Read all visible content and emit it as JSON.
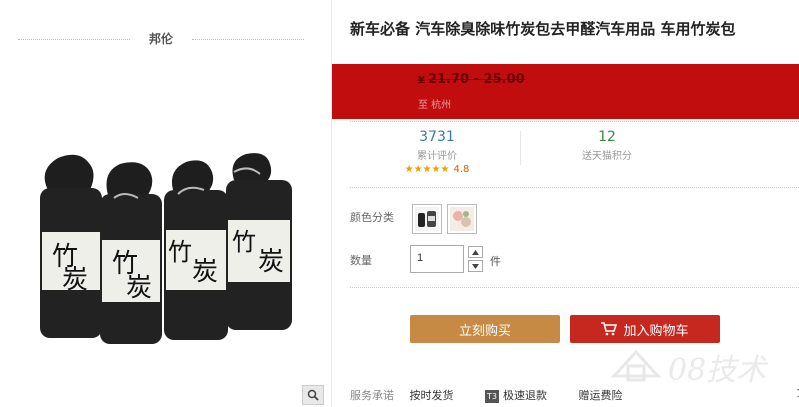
{
  "brand": {
    "name": "邦伦"
  },
  "product": {
    "title": "新车必备 汽车除臭除味竹炭包去甲醛汽车用品 车用竹炭包",
    "image_label_chars": [
      "竹",
      "炭"
    ]
  },
  "price": {
    "currency": "¥",
    "range": "21.70 - 25.00",
    "ship_to": "至 杭州"
  },
  "stats": {
    "reviews": {
      "value": "3731",
      "label": "累计评价"
    },
    "rating": {
      "stars": "★★★★★",
      "score": "4.8"
    },
    "points": {
      "value": "12",
      "label": "送天猫积分"
    }
  },
  "options": {
    "color_label": "颜色分类",
    "quantity_label": "数量",
    "quantity_value": "1",
    "quantity_unit": "件"
  },
  "actions": {
    "buy_now": "立刻购买",
    "add_to_cart": "加入购物车"
  },
  "service": {
    "label": "服务承诺",
    "items": [
      "按时发货",
      "极速退款",
      "赠运费险"
    ],
    "t3_badge": "T3",
    "edge_number": "1"
  },
  "watermark": {
    "text": "08技术"
  },
  "colors": {
    "price_band": "#c10d0d",
    "buy_button": "#c68a44",
    "cart_button": "#c62820",
    "reviews_count": "#3a78b5",
    "points_count": "#3a8b3a",
    "stars": "#f0a000"
  }
}
